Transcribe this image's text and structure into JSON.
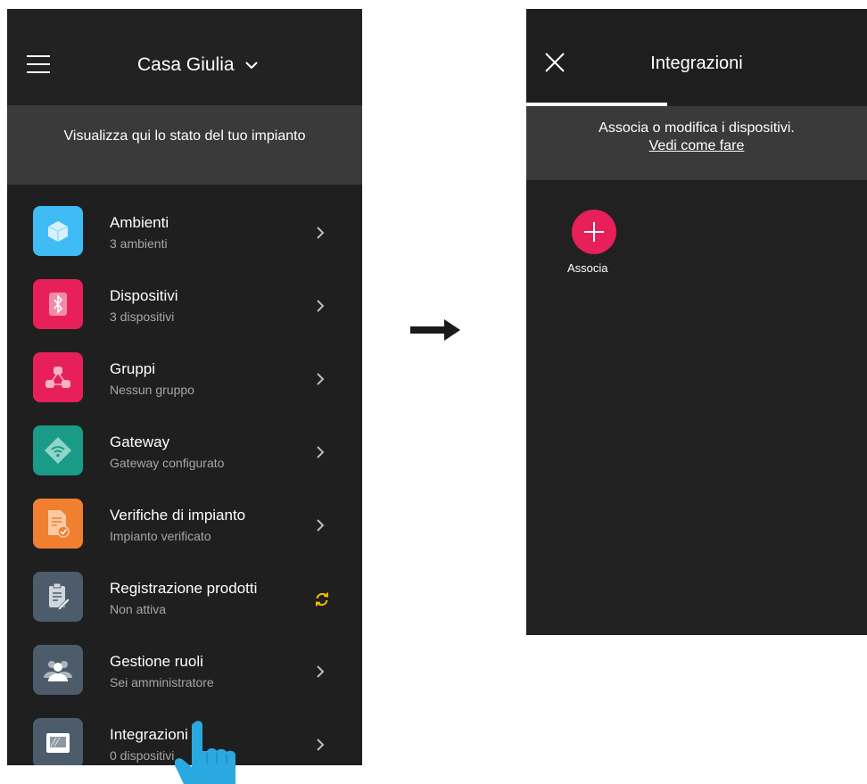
{
  "left_screen": {
    "home_name": "Casa Giulia",
    "status_text": "Visualizza qui lo stato del tuo impianto",
    "items": [
      {
        "title": "Ambienti",
        "subtitle": "3 ambienti",
        "icon": "cube-icon",
        "color": "#3fbbf5",
        "action": "chevron"
      },
      {
        "title": "Dispositivi",
        "subtitle": "3 dispositivi",
        "icon": "bluetooth-icon",
        "color": "#e8205a",
        "action": "chevron"
      },
      {
        "title": "Gruppi",
        "subtitle": "Nessun gruppo",
        "icon": "group-icon",
        "color": "#e8205a",
        "action": "chevron"
      },
      {
        "title": "Gateway",
        "subtitle": "Gateway configurato",
        "icon": "wifi-icon",
        "color": "#1a9b88",
        "action": "chevron"
      },
      {
        "title": "Verifiche di impianto",
        "subtitle": "Impianto verificato",
        "icon": "document-check-icon",
        "color": "#f08030",
        "action": "chevron"
      },
      {
        "title": "Registrazione prodotti",
        "subtitle": "Non attiva",
        "icon": "clipboard-edit-icon",
        "color": "#4c5c6a",
        "action": "sync"
      },
      {
        "title": "Gestione ruoli",
        "subtitle": "Sei amministratore",
        "icon": "users-icon",
        "color": "#4c5c6a",
        "action": "chevron"
      },
      {
        "title": "Integrazioni",
        "subtitle": "0 dispositivi",
        "icon": "screen-icon",
        "color": "#4c5c6a",
        "action": "chevron"
      }
    ]
  },
  "right_screen": {
    "title": "Integrazioni",
    "subtitle": "Associa o modifica i dispositivi.",
    "link": "Vedi come fare",
    "add_label": "Associa",
    "accent": "#e8205a"
  },
  "colors": {
    "sync_icon": "#f5b800",
    "hand": "#2aa8e0"
  }
}
